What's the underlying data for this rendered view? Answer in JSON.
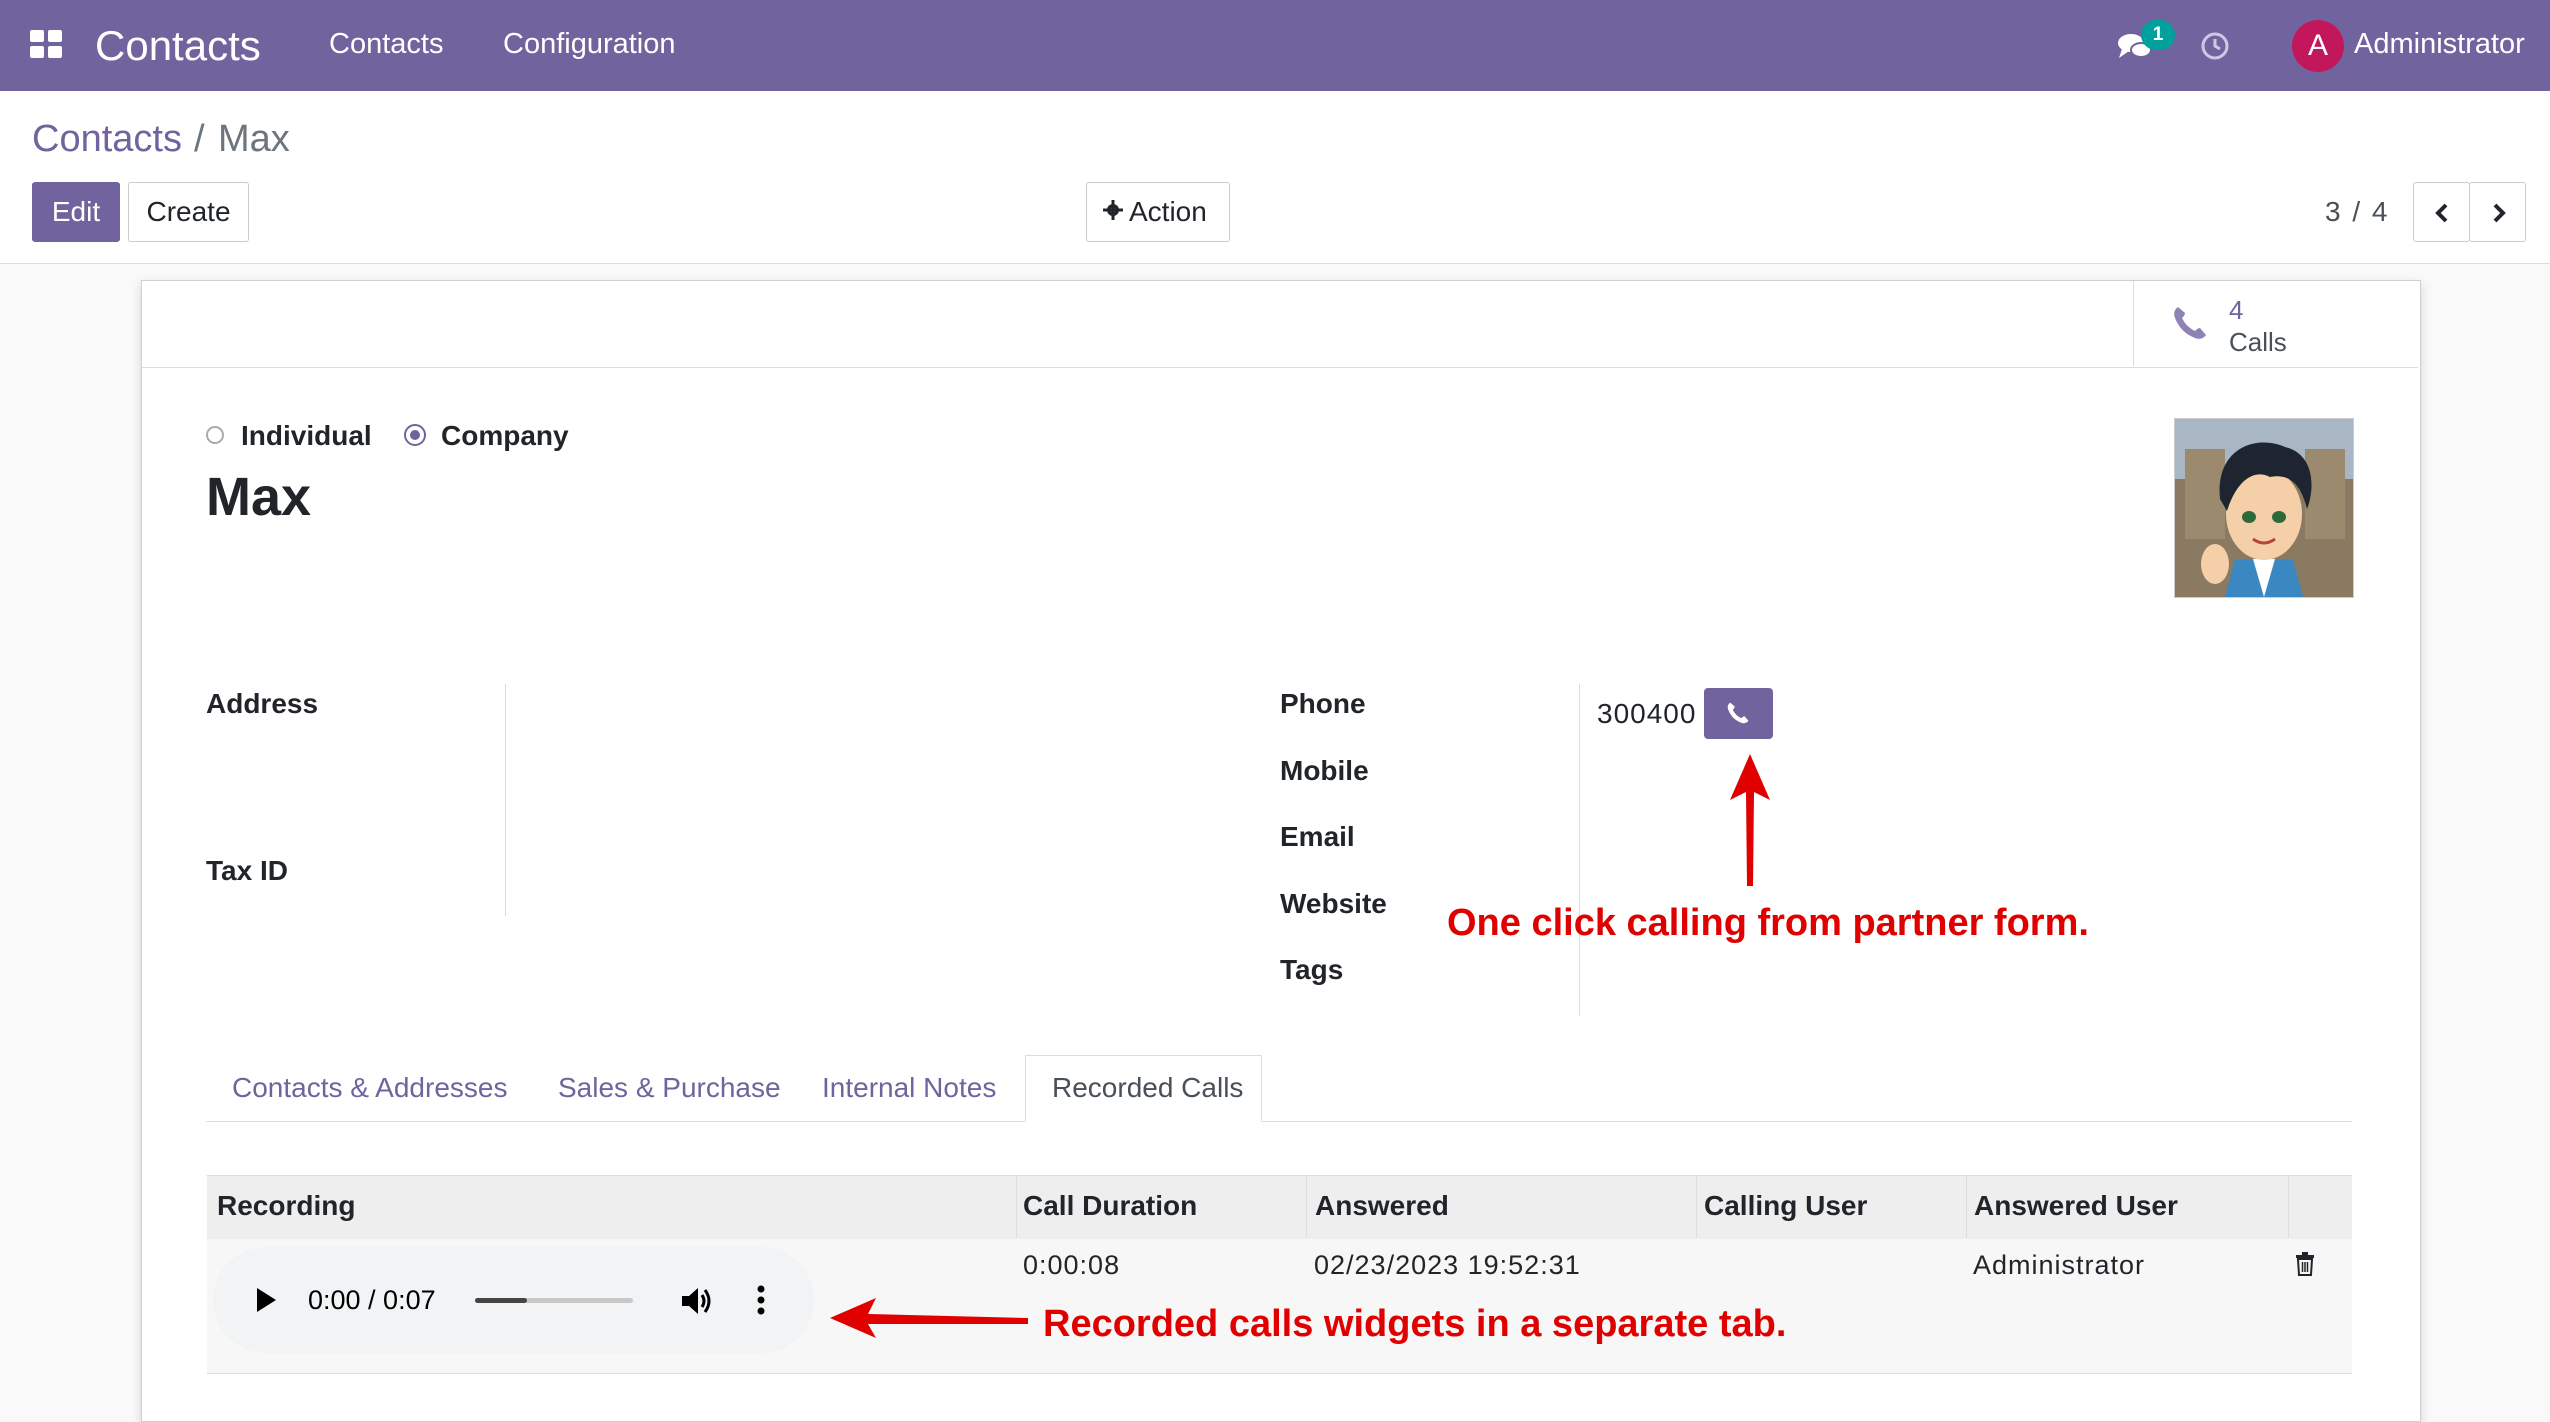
{
  "navbar": {
    "app_title": "Contacts",
    "menu": [
      "Contacts",
      "Configuration"
    ],
    "message_count": "1",
    "user_initial": "A",
    "user_name": "Administrator"
  },
  "breadcrumb": {
    "parent": "Contacts",
    "separator": "/",
    "current": "Max"
  },
  "toolbar": {
    "edit_label": "Edit",
    "create_label": "Create",
    "action_label": "Action"
  },
  "pager": {
    "text": "3 / 4"
  },
  "smart_button": {
    "count": "4",
    "label": "Calls"
  },
  "company_type": {
    "individual_label": "Individual",
    "company_label": "Company",
    "selected": "Company"
  },
  "partner": {
    "name": "Max"
  },
  "left_fields": {
    "address_label": "Address",
    "tax_id_label": "Tax ID"
  },
  "right_fields": {
    "phone_label": "Phone",
    "phone_value": "300400",
    "mobile_label": "Mobile",
    "email_label": "Email",
    "website_label": "Website",
    "tags_label": "Tags"
  },
  "notebook": {
    "tabs": [
      "Contacts & Addresses",
      "Sales & Purchase",
      "Internal Notes",
      "Recorded Calls"
    ],
    "active_tab": "Recorded Calls"
  },
  "calls_table": {
    "headers": [
      "Recording",
      "Call Duration",
      "Answered",
      "Calling User",
      "Answered User"
    ],
    "rows": [
      {
        "call_duration": "0:00:08",
        "answered": "02/23/2023 19:52:31",
        "calling_user": "",
        "answered_user": "Administrator"
      }
    ],
    "audio_time": "0:00 / 0:07",
    "audio_progress": 0.33
  },
  "annotations": {
    "call_note": "One click calling from partner form.",
    "recording_note": "Recorded calls widgets in a separate tab."
  },
  "colors": {
    "brand": "#71639e",
    "accent_badge": "#00a09d",
    "annotation": "#e00000"
  }
}
